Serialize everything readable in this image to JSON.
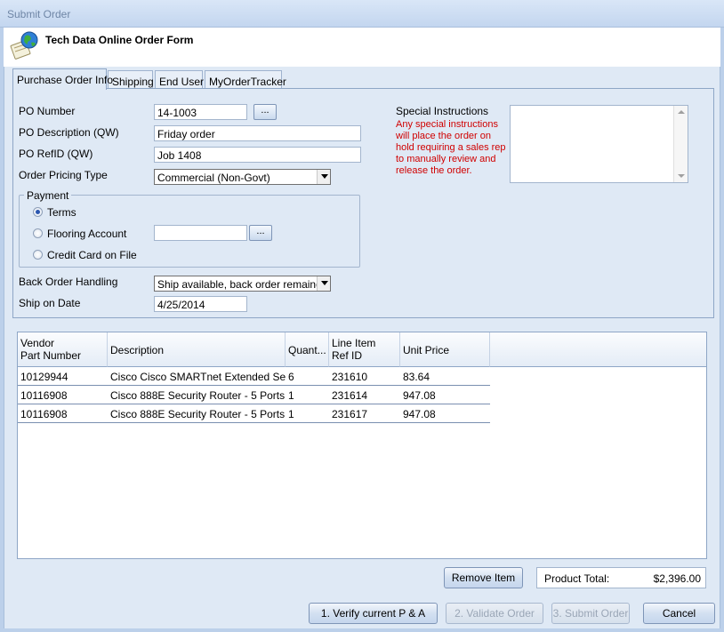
{
  "window": {
    "title": "Submit Order"
  },
  "header": {
    "title": "Tech Data Online Order Form"
  },
  "tabs": [
    {
      "label": "Purchase Order Info"
    },
    {
      "label": "Shipping"
    },
    {
      "label": "End User"
    },
    {
      "label": "MyOrderTracker"
    }
  ],
  "form": {
    "po_number": {
      "label": "PO Number",
      "value": "14-1003",
      "button": "..."
    },
    "po_description": {
      "label": "PO Description (QW)",
      "value": "Friday order"
    },
    "po_refid": {
      "label": "PO RefID (QW)",
      "value": "Job 1408"
    },
    "pricing_type": {
      "label": "Order Pricing Type",
      "value": "Commercial (Non-Govt)"
    },
    "payment": {
      "label": "Payment",
      "terms": "Terms",
      "flooring": "Flooring Account",
      "flooring_value": "",
      "flooring_button": "...",
      "credit_card": "Credit Card on File",
      "selected": "Terms"
    },
    "back_order": {
      "label": "Back Order Handling",
      "value": "Ship available, back order remainder"
    },
    "ship_on_date": {
      "label": "Ship on Date",
      "value": "4/25/2014"
    },
    "special_instructions": {
      "label": "Special Instructions",
      "note": "Any special instructions will place the order on hold requiring a sales rep to manually review and release the order.",
      "value": ""
    }
  },
  "grid": {
    "headers": {
      "vendor_part_1": "Vendor",
      "vendor_part_2": "Part Number",
      "description": "Description",
      "quantity": "Quant...",
      "line_item_1": "Line Item",
      "line_item_2": "Ref ID",
      "unit_price": "Unit Price"
    },
    "rows": [
      {
        "part": "10129944",
        "description": "Cisco Cisco SMARTnet Extended Se...",
        "qty": "6",
        "ref": "231610",
        "price": "83.64"
      },
      {
        "part": "10116908",
        "description": "Cisco 888E Security Router - 5 Ports...",
        "qty": "1",
        "ref": "231614",
        "price": "947.08"
      },
      {
        "part": "10116908",
        "description": "Cisco 888E Security Router - 5 Ports...",
        "qty": "1",
        "ref": "231617",
        "price": "947.08"
      }
    ]
  },
  "actions": {
    "remove_item": "Remove Item",
    "product_total_label": "Product Total:",
    "product_total_value": "$2,396.00",
    "verify": "1. Verify current P & A",
    "validate": "2. Validate Order",
    "submit": "3. Submit Order",
    "cancel": "Cancel"
  },
  "icons": {
    "app": "globe-document-icon",
    "dropdown": "chevron-down-icon"
  }
}
